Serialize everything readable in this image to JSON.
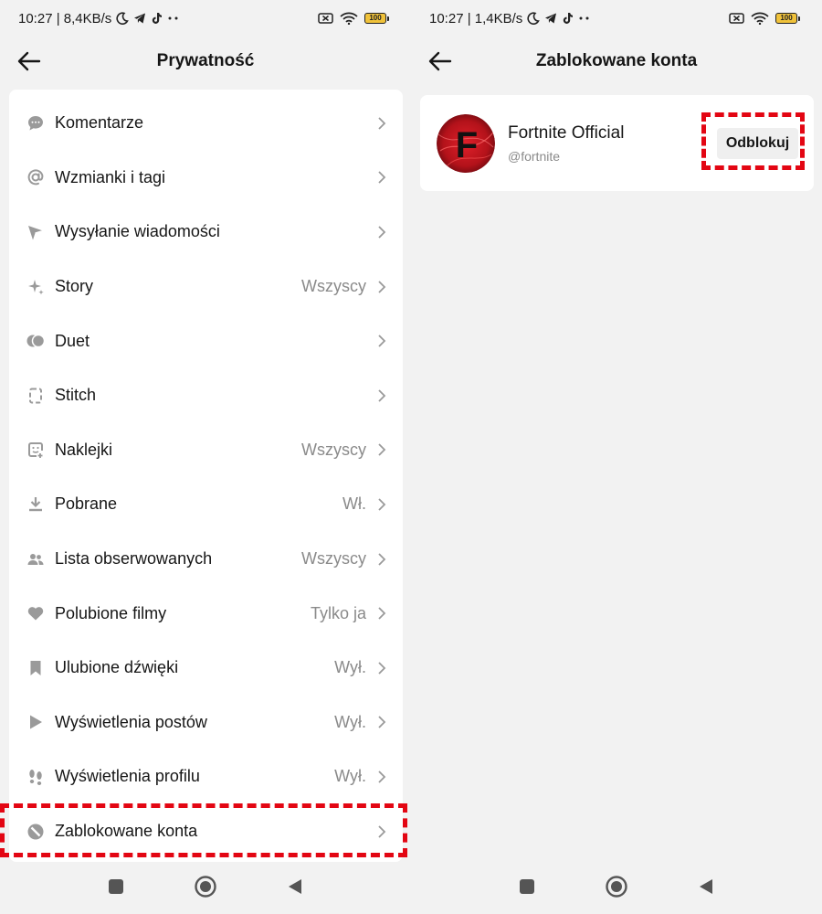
{
  "status_left": {
    "time": "10:27",
    "speed": "| 8,4KB/s",
    "battery": "100"
  },
  "status_right": {
    "time": "10:27",
    "speed": "| 1,4KB/s",
    "battery": "100"
  },
  "privacy": {
    "title": "Prywatność",
    "rows": [
      {
        "label": "Komentarze",
        "value": "",
        "icon": "comment-icon"
      },
      {
        "label": "Wzmianki i tagi",
        "value": "",
        "icon": "at-sign-icon"
      },
      {
        "label": "Wysyłanie wiadomości",
        "value": "",
        "icon": "send-icon"
      },
      {
        "label": "Story",
        "value": "Wszyscy",
        "icon": "sparkle-icon"
      },
      {
        "label": "Duet",
        "value": "",
        "icon": "duet-icon"
      },
      {
        "label": "Stitch",
        "value": "",
        "icon": "stitch-icon"
      },
      {
        "label": "Naklejki",
        "value": "Wszyscy",
        "icon": "sticker-icon"
      },
      {
        "label": "Pobrane",
        "value": "Wł.",
        "icon": "download-icon"
      },
      {
        "label": "Lista obserwowanych",
        "value": "Wszyscy",
        "icon": "people-icon"
      },
      {
        "label": "Polubione filmy",
        "value": "Tylko ja",
        "icon": "heart-icon"
      },
      {
        "label": "Ulubione dźwięki",
        "value": "Wył.",
        "icon": "bookmark-icon"
      },
      {
        "label": "Wyświetlenia postów",
        "value": "Wył.",
        "icon": "play-icon"
      },
      {
        "label": "Wyświetlenia profilu",
        "value": "Wył.",
        "icon": "footprints-icon"
      },
      {
        "label": "Zablokowane konta",
        "value": "",
        "icon": "block-icon"
      }
    ]
  },
  "blocked": {
    "title": "Zablokowane konta",
    "account": {
      "name": "Fortnite Official",
      "handle": "@fortnite",
      "avatar_letter": "F"
    },
    "unblock_label": "Odblokuj"
  },
  "colors": {
    "highlight": "#e30613",
    "card": "#ffffff",
    "background": "#f2f2f2",
    "icon": "#9a9a9a"
  }
}
